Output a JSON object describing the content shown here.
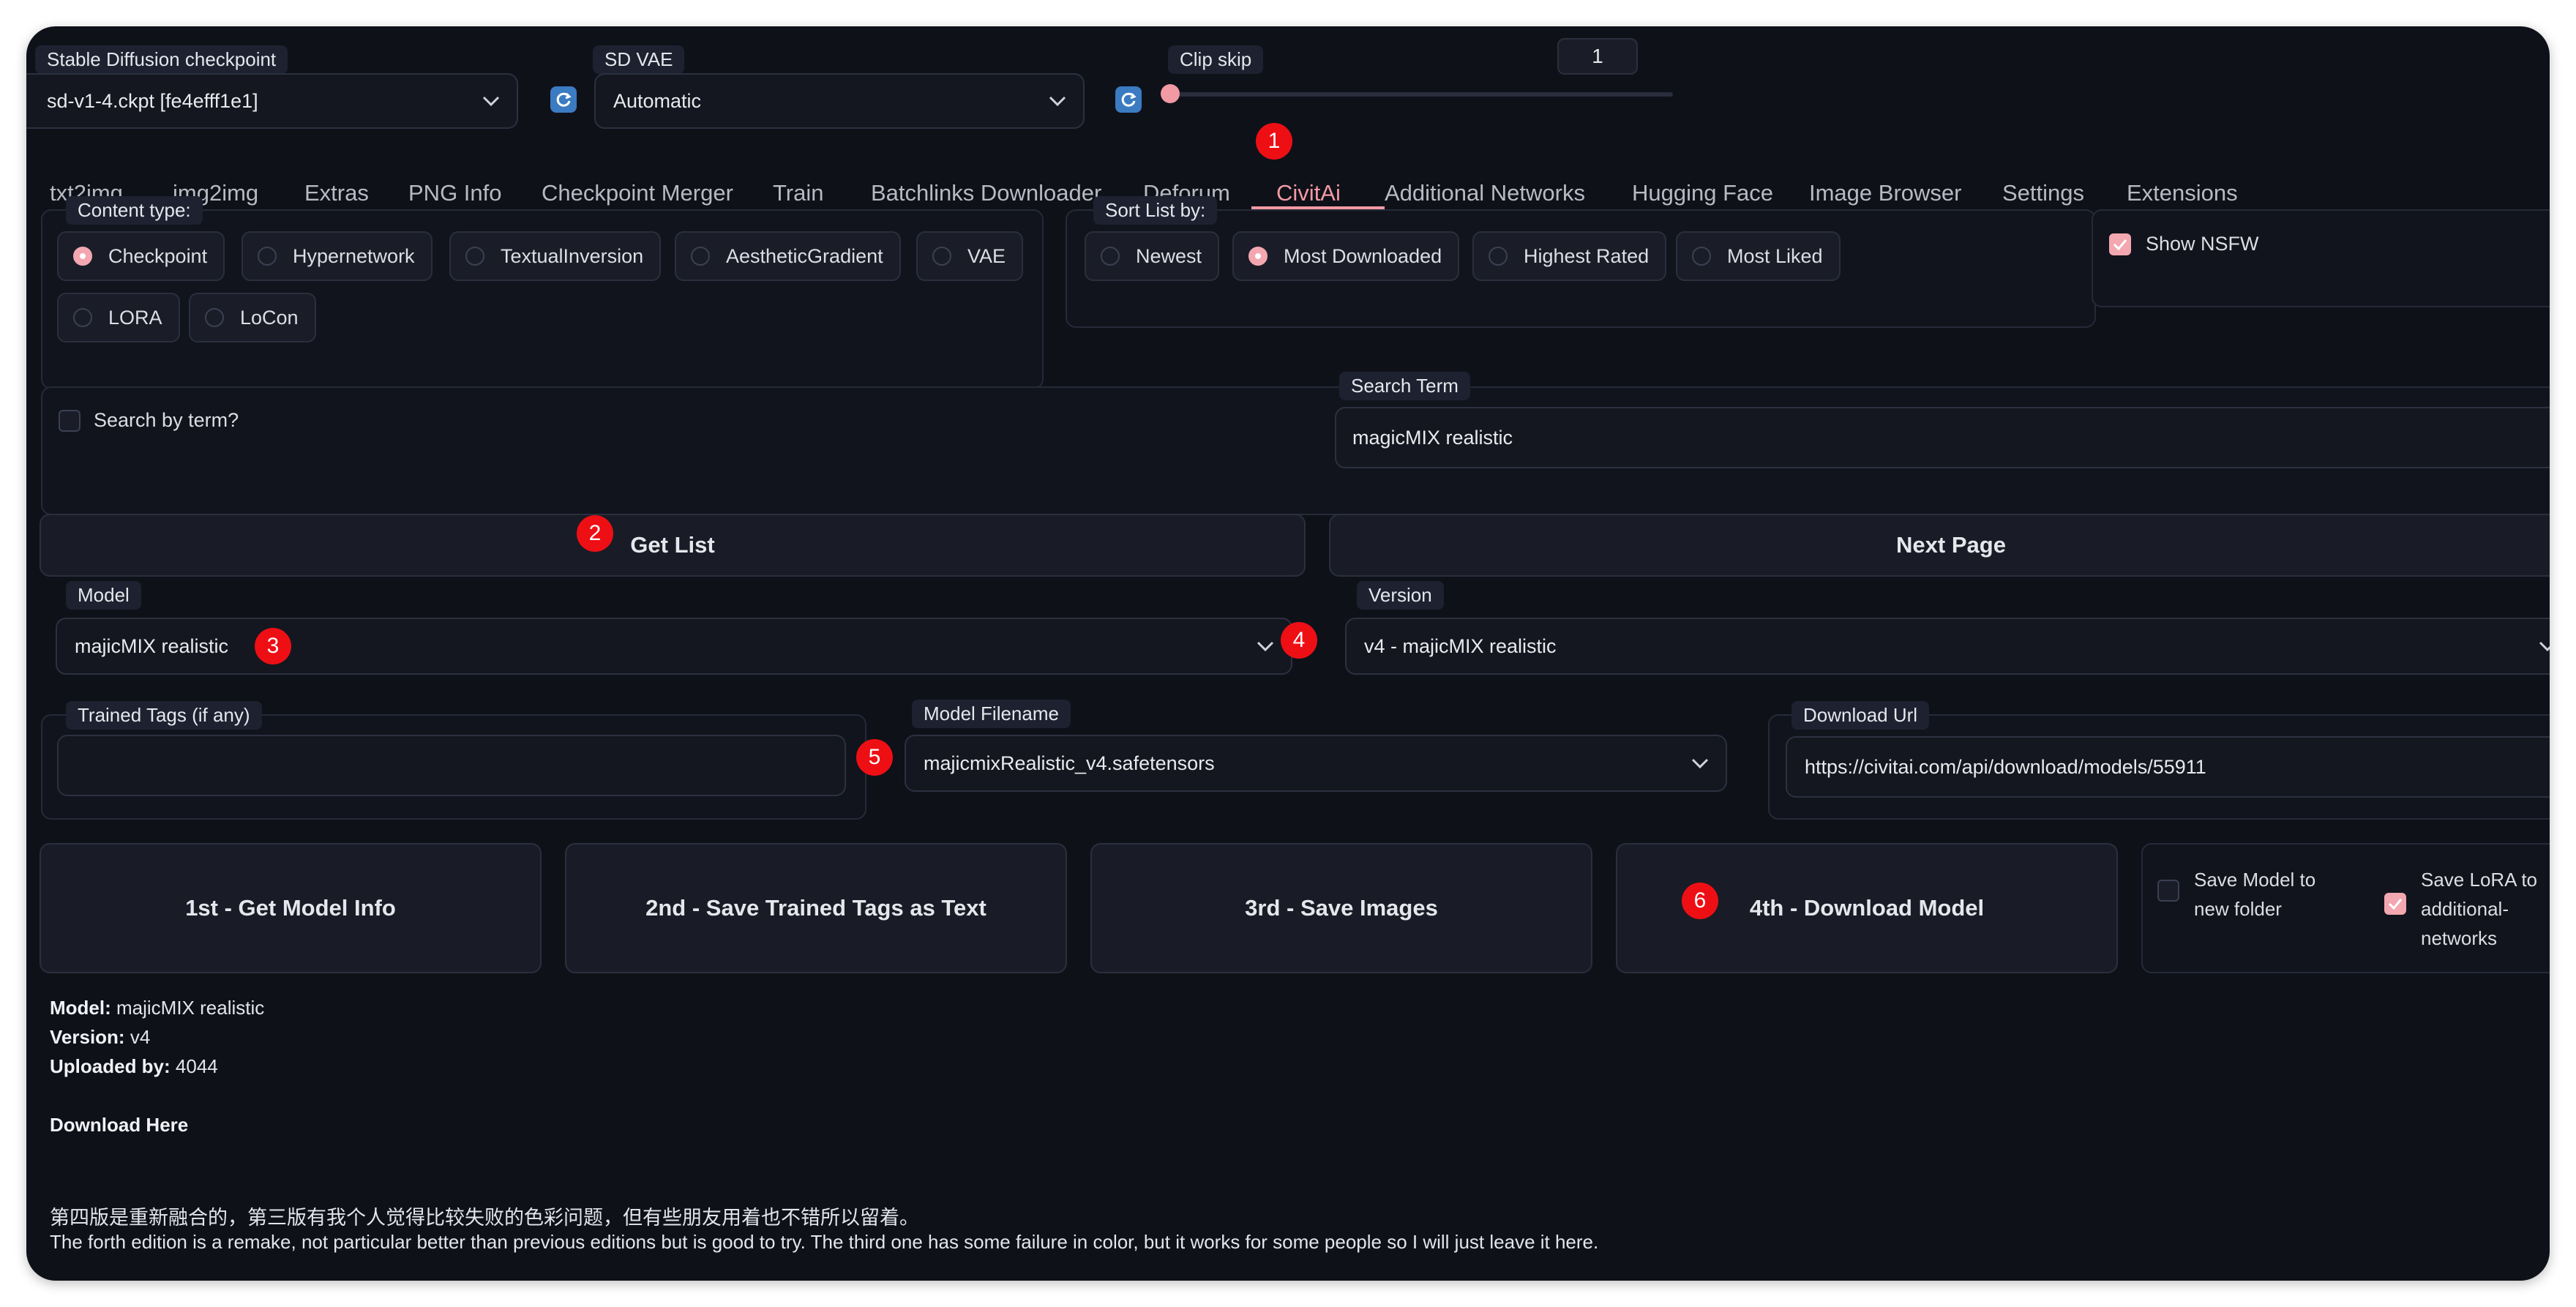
{
  "top": {
    "checkpoint": {
      "label": "Stable Diffusion checkpoint",
      "value": "sd-v1-4.ckpt [fe4efff1e1]"
    },
    "vae": {
      "label": "SD VAE",
      "value": "Automatic"
    },
    "clip_skip": {
      "label": "Clip skip",
      "value": "1",
      "level": 0.0
    }
  },
  "tabs": [
    "txt2img",
    "img2img",
    "Extras",
    "PNG Info",
    "Checkpoint Merger",
    "Train",
    "Batchlinks Downloader",
    "Deforum",
    "CivitAi",
    "Additional Networks",
    "Hugging Face",
    "Image Browser",
    "Settings",
    "Extensions"
  ],
  "active_tab": "CivitAi",
  "content_type": {
    "label": "Content type:",
    "options": [
      "Checkpoint",
      "Hypernetwork",
      "TextualInversion",
      "AestheticGradient",
      "VAE",
      "LORA",
      "LoCon"
    ],
    "selected": "Checkpoint"
  },
  "sort": {
    "label": "Sort List by:",
    "options": [
      "Newest",
      "Most Downloaded",
      "Highest Rated",
      "Most Liked"
    ],
    "selected": "Most Downloaded"
  },
  "nsfw": {
    "label": "Show NSFW",
    "checked": true
  },
  "search": {
    "checkbox_label": "Search by term?",
    "term_label": "Search Term",
    "term_value": "magicMIX realistic"
  },
  "buttons": {
    "get_list": "Get List",
    "next_page": "Next Page",
    "get_info": "1st - Get Model Info",
    "save_tags": "2nd - Save Trained Tags as Text",
    "save_images": "3rd - Save Images",
    "download": "4th - Download Model"
  },
  "model": {
    "label": "Model",
    "value": "majicMIX realistic"
  },
  "version": {
    "label": "Version",
    "value": "v4 - majicMIX realistic"
  },
  "trained_tags": {
    "label": "Trained Tags (if any)",
    "value": ""
  },
  "model_filename": {
    "label": "Model Filename",
    "value": "majicmixRealistic_v4.safetensors"
  },
  "download_url": {
    "label": "Download Url",
    "value": "https://civitai.com/api/download/models/55911"
  },
  "options": {
    "save_folder": {
      "label_line1": "Save Model to",
      "label_line2": "new folder",
      "checked": false
    },
    "save_lora": {
      "label_line1": "Save LoRA to",
      "label_line2": "additional-",
      "label_line3": "networks",
      "checked": true
    }
  },
  "info": {
    "model_key": "Model:",
    "model_val": "majicMIX realistic",
    "version_key": "Version:",
    "version_val": "v4",
    "uploader_key": "Uploaded by:",
    "uploader_val": "4044",
    "download_link": "Download Here",
    "desc_cn": "第四版是重新融合的，第三版有我个人觉得比较失败的色彩问题，但有些朋友用着也不错所以留着。",
    "desc_en": "The forth edition is a remake, not particular better than previous editions but is good to try. The third one has some failure in color, but it works for some people so I will just leave it here."
  },
  "badges": [
    "1",
    "2",
    "3",
    "4",
    "5",
    "6"
  ],
  "colors": {
    "accent": "#f29aa4",
    "badge": "#ee0f15",
    "background": "#0f1119"
  }
}
